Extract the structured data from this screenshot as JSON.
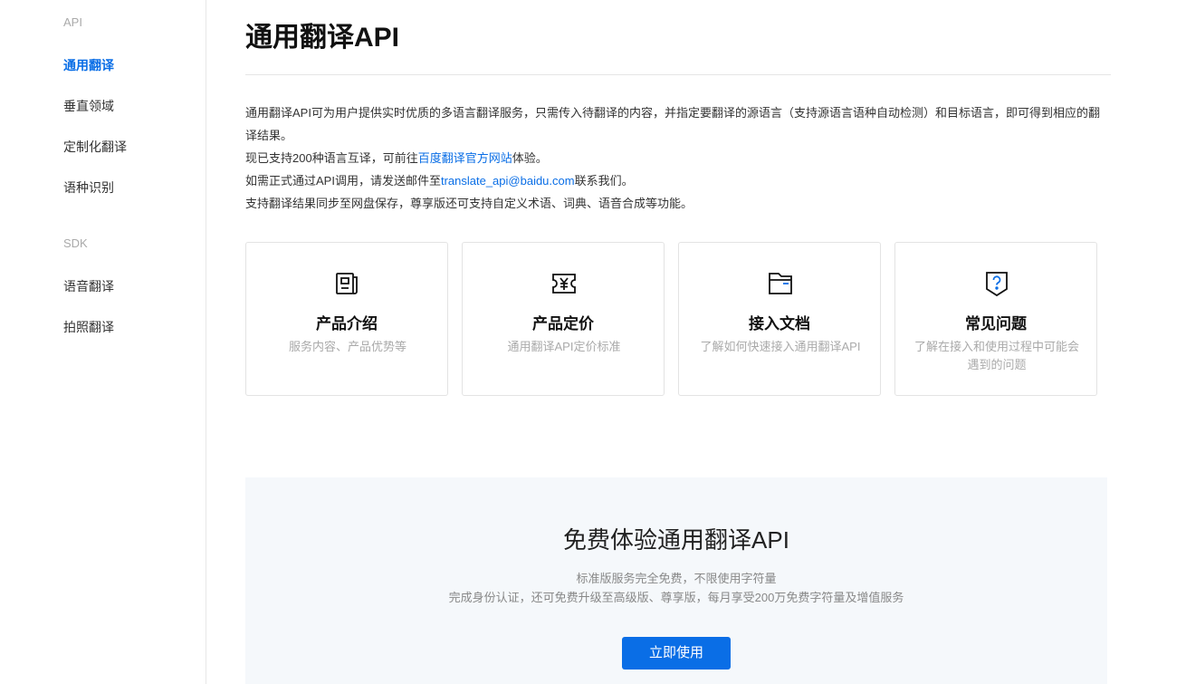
{
  "sidebar": {
    "api_group": "API",
    "api_items": [
      "通用翻译",
      "垂直领域",
      "定制化翻译",
      "语种识别"
    ],
    "sdk_group": "SDK",
    "sdk_items": [
      "语音翻译",
      "拍照翻译"
    ]
  },
  "page": {
    "title": "通用翻译API",
    "intro_line1": "通用翻译API可为用户提供实时优质的多语言翻译服务，只需传入待翻译的内容，并指定要翻译的源语言（支持源语言语种自动检测）和目标语言，即可得到相应的翻译结果。",
    "intro_line2_prefix": "现已支持200种语言互译，可前往",
    "intro_line2_link": "百度翻译官方网站",
    "intro_line2_suffix": "体验。",
    "intro_line3_prefix": "如需正式通过API调用，请发送邮件至",
    "intro_line3_email": "translate_api@baidu.com",
    "intro_line3_suffix": "联系我们。",
    "intro_line4": "支持翻译结果同步至网盘保存，尊享版还可支持自定义术语、词典、语音合成等功能。"
  },
  "cards": [
    {
      "title": "产品介绍",
      "desc": "服务内容、产品优势等",
      "icon": "product-intro-icon"
    },
    {
      "title": "产品定价",
      "desc": "通用翻译API定价标准",
      "icon": "pricing-icon"
    },
    {
      "title": "接入文档",
      "desc": "了解如何快速接入通用翻译API",
      "icon": "document-folder-icon"
    },
    {
      "title": "常见问题",
      "desc": "了解在接入和使用过程中可能会遇到的问题",
      "icon": "faq-icon"
    }
  ],
  "promo": {
    "title": "免费体验通用翻译API",
    "sub1": "标准版服务完全免费，不限使用字符量",
    "sub2": "完成身份认证，还可免费升级至高级版、尊享版，每月享受200万免费字符量及增值服务",
    "button": "立即使用"
  },
  "colors": {
    "accent": "#0a6ee6",
    "promo_bg": "#f5f8fb"
  }
}
